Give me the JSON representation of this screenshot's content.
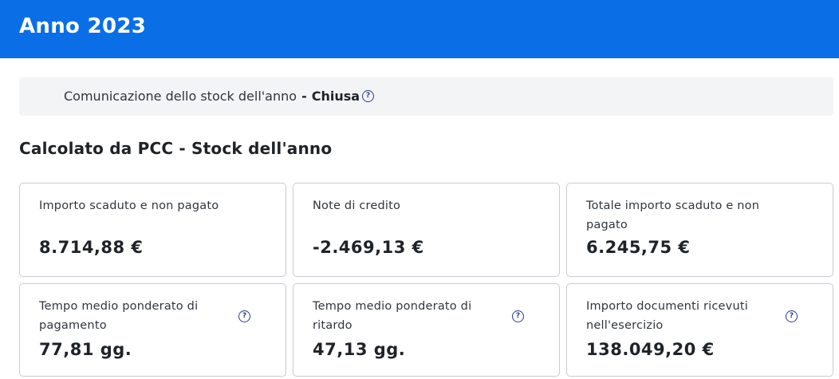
{
  "header": {
    "title": "Anno 2023"
  },
  "notice": {
    "text": "Comunicazione dello stock dell'anno",
    "separator": "-",
    "status": "Chiusa",
    "help_icon": "question-circle-icon"
  },
  "section": {
    "title": "Calcolato da PCC - Stock dell'anno"
  },
  "cards": [
    {
      "label": "Importo scaduto e non pagato",
      "value": "8.714,88 €"
    },
    {
      "label": "Note di credito",
      "value": "-2.469,13 €"
    },
    {
      "label": "Totale importo scaduto e non pagato",
      "value": "6.245,75 €"
    },
    {
      "label": "Tempo medio ponderato di pagamento",
      "value": "77,81 gg.",
      "help_icon": "question-circle-icon"
    },
    {
      "label": "Tempo medio ponderato di ritardo",
      "value": "47,13 gg.",
      "help_icon": "question-circle-icon"
    },
    {
      "label": "Importo documenti ricevuti nell'esercizio",
      "value": "138.049,20 €",
      "help_icon": "question-circle-icon"
    }
  ],
  "colors": {
    "header_bg": "#0a6fe6",
    "notice_bg": "#f3f4f6",
    "icon": "#2b3a8f",
    "card_border": "#c8ccd1"
  }
}
